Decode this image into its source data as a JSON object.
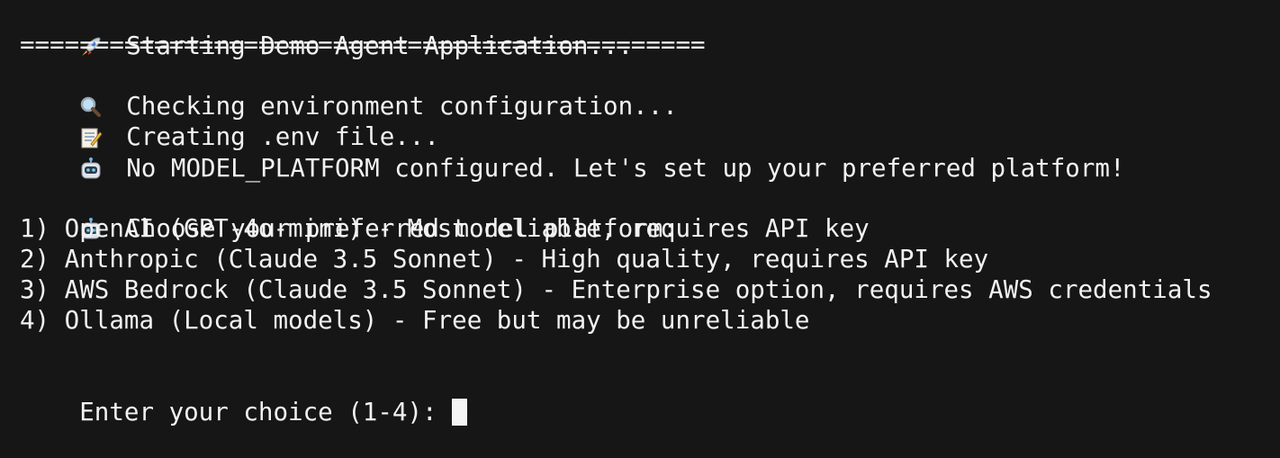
{
  "terminal": {
    "lines": [
      {
        "icon": "rocket-icon",
        "text": "Starting Demo Agent Application..."
      },
      {
        "icon": null,
        "text": "=============================================="
      },
      {
        "icon": "magnifier-icon",
        "text": "Checking environment configuration..."
      },
      {
        "icon": "memo-icon",
        "text": "Creating .env file..."
      },
      {
        "icon": "robot-icon",
        "text": "No MODEL_PLATFORM configured. Let's set up your preferred platform!"
      },
      {
        "icon": "robot-icon",
        "text": "Choose your preferred model platform:"
      },
      {
        "icon": null,
        "text": "1) OpenAI (GPT-4o-mini) - Most reliable, requires API key"
      },
      {
        "icon": null,
        "text": "2) Anthropic (Claude 3.5 Sonnet) - High quality, requires API key"
      },
      {
        "icon": null,
        "text": "3) AWS Bedrock (Claude 3.5 Sonnet) - Enterprise option, requires AWS credentials"
      },
      {
        "icon": null,
        "text": "4) Ollama (Local models) - Free but may be unreliable"
      }
    ],
    "prompt": "Enter your choice (1-4):"
  },
  "colors": {
    "background": "#161616",
    "foreground": "#f2f2f2",
    "cursor": "#f4f4f4"
  }
}
